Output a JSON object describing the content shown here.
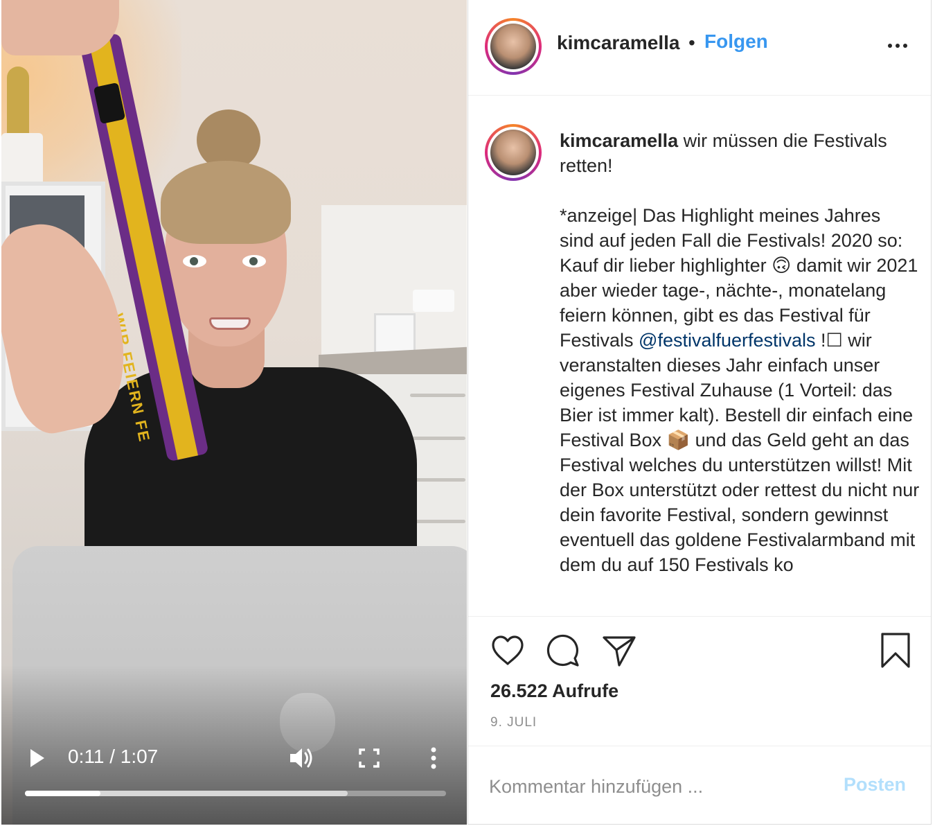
{
  "video": {
    "current_time": "0:11",
    "duration": "1:07",
    "time_display": "0:11 / 1:07",
    "progress_fraction": 0.18,
    "buffered_fraction": 0.767,
    "wristband_text": "WIR FEIERN FE"
  },
  "header": {
    "username": "kimcaramella",
    "separator": "•",
    "follow_label": "Folgen"
  },
  "caption": {
    "username": "kimcaramella",
    "title_text": " wir müssen die Festivals retten!",
    "body_before_mention": "*anzeige| Das Highlight meines Jahres sind auf jeden Fall die Festivals! 2020 so: Kauf dir lieber highlighter 🙃 damit wir 2021 aber wieder tage-, nächte-, monatelang feiern können, gibt es das Festival für Festivals ",
    "mention": "@festivalfuerfestivals",
    "body_after_mention": " !☐ wir veranstalten dieses Jahr einfach unser eigenes Festival Zuhause (1 Vorteil: das Bier ist immer kalt). Bestell dir einfach eine Festival Box 📦 und das Geld geht an das Festival welches du unterstützen willst! Mit der Box unterstützt oder rettest du nicht nur dein favorite Festival, sondern gewinnst eventuell das goldene Festivalarmband mit dem du auf 150 Festivals ko"
  },
  "stats": {
    "views_count": "26.522",
    "views_label": "Aufrufe",
    "date": "9. JULI"
  },
  "comment": {
    "placeholder": "Kommentar hinzufügen ...",
    "post_label": "Posten"
  },
  "icons": {
    "play": "play-icon",
    "volume": "volume-icon",
    "fullscreen": "fullscreen-icon",
    "video_more": "kebab-menu-icon",
    "header_more": "more-dots-icon",
    "like": "heart-icon",
    "comment": "comment-bubble-icon",
    "share": "paper-plane-icon",
    "save": "bookmark-icon"
  },
  "colors": {
    "link_blue": "#3897f0",
    "mention_blue": "#003569",
    "post_disabled": "#b2dffc",
    "muted_gray": "#8e8e8e",
    "text": "#262626"
  }
}
